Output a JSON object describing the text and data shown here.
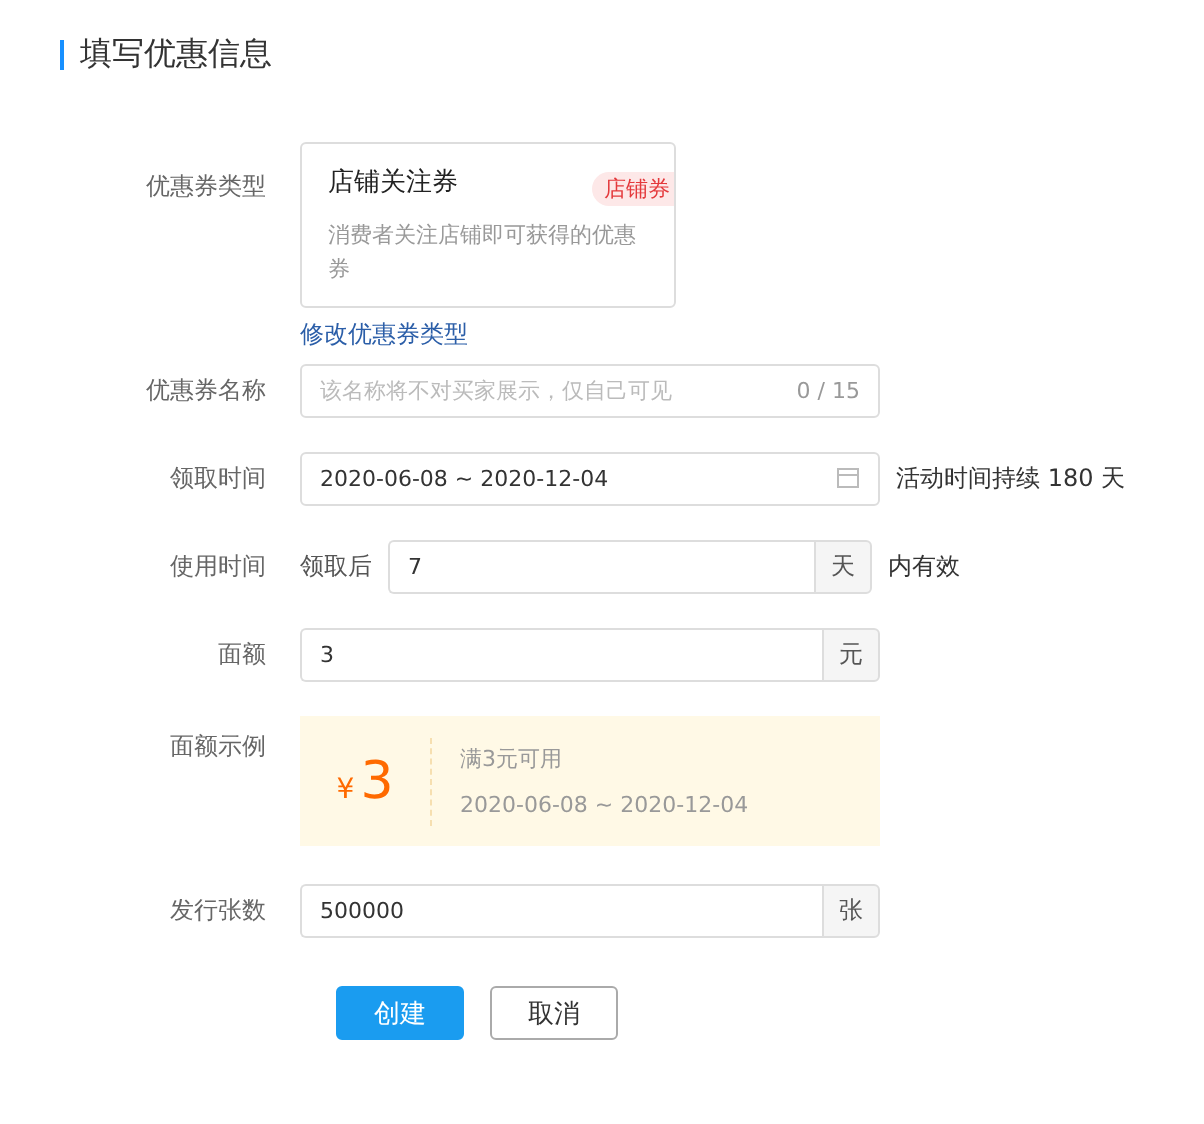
{
  "title": "填写优惠信息",
  "coupon_type": {
    "label": "优惠券类型",
    "card_title": "店铺关注券",
    "tag": "店铺券",
    "description": "消费者关注店铺即可获得的优惠券",
    "change_link": "修改优惠券类型"
  },
  "fields": [
    {
      "kind": "text",
      "label": "优惠券名称",
      "placeholder": "该名称将不对买家展示，仅自己可见",
      "counter": "0 / 15"
    },
    {
      "kind": "date",
      "label": "领取时间",
      "value": "2020-06-08 ~ 2020-12-04",
      "note": "活动时间持续 180 天"
    },
    {
      "kind": "suffix",
      "label": "使用时间",
      "prefix": "领取后",
      "value": "7",
      "unit": "天",
      "note": "内有效"
    },
    {
      "kind": "suffix",
      "label": "面额",
      "value": "3",
      "unit": "元"
    },
    {
      "kind": "preview",
      "label": "面额示例",
      "currency": "¥",
      "amount": "3",
      "condition": "满3元可用",
      "dates": "2020-06-08 ~ 2020-12-04"
    },
    {
      "kind": "suffix",
      "label": "发行张数",
      "value": "500000",
      "unit": "张"
    }
  ],
  "buttons": [
    {
      "label": "创建",
      "kind": "primary"
    },
    {
      "label": "取消",
      "kind": "default"
    }
  ]
}
